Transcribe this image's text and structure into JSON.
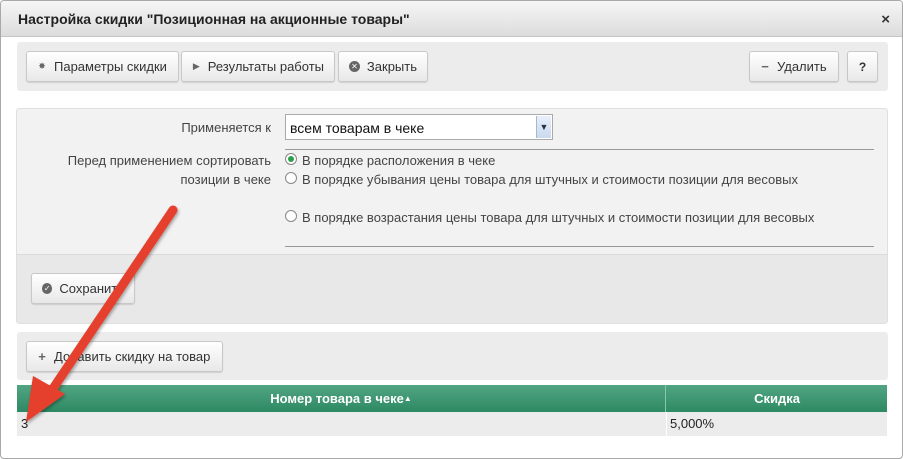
{
  "window": {
    "title": "Настройка скидки \"Позиционная на акционные товары\"",
    "close_glyph": "×"
  },
  "toolbar": {
    "params_label": "Параметры скидки",
    "results_label": "Результаты работы",
    "close_label": "Закрыть",
    "delete_label": "Удалить",
    "help_label": "?"
  },
  "form": {
    "applies_label": "Применяется к",
    "applies_value": "всем товарам в чеке",
    "sort_label": "Перед применением сортировать позиции в чеке",
    "sort_options": [
      {
        "label": "В порядке расположения в чеке",
        "selected": true
      },
      {
        "label": "В порядке убывания цены товара для штучных и стоимости позиции для весовых",
        "selected": false
      },
      {
        "label": "В порядке возрастания цены товара для штучных и стоимости позиции для весовых",
        "selected": false
      }
    ],
    "save_label": "Сохранить"
  },
  "items": {
    "add_label": "Добавить скидку на товар",
    "columns": [
      "Номер товара в чеке",
      "Скидка"
    ],
    "sort_indicator": "▲",
    "rows": [
      {
        "position": "3",
        "discount": "5,000%"
      }
    ]
  },
  "colors": {
    "header_green": "#2d8a63",
    "arrow_red": "#e5412d"
  },
  "icons": {
    "params": "gear-icon",
    "results": "play-icon",
    "close": "close-circle-icon",
    "delete": "minus-icon",
    "save": "check-circle-icon",
    "add": "plus-icon"
  }
}
